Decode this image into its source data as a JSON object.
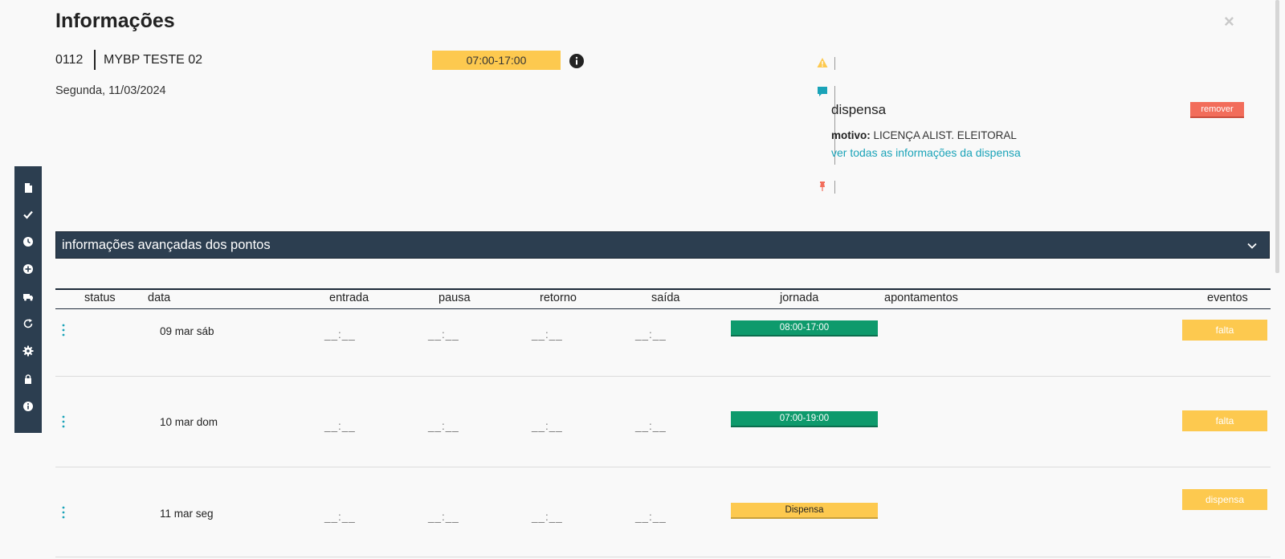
{
  "header": {
    "title": "Informações",
    "close": "×",
    "employee_code": "0112",
    "employee_name": "MYBP TESTE 02",
    "date": "Segunda, 11/03/2024",
    "shift": "07:00-17:00"
  },
  "side_panel": {
    "dispensa_title": "dispensa",
    "remove_label": "remover",
    "motivo_label": "motivo:",
    "motivo_value": "LICENÇA ALIST. ELEITORAL",
    "link": "ver todas as informações da dispensa",
    "colors": {
      "warning": "#fdc94f",
      "comment": "#1aa3b8",
      "pin": "#f26d5b",
      "remove": "#f26d5b"
    }
  },
  "toolbar": {
    "icons": [
      "file-icon",
      "check-icon",
      "clock-icon",
      "plus-circle-icon",
      "truck-icon",
      "refresh-icon",
      "gear-icon",
      "lock-icon",
      "info-icon"
    ]
  },
  "advanced": {
    "label": "informações avançadas dos pontos"
  },
  "table": {
    "headers": {
      "status": "status",
      "data": "data",
      "entrada": "entrada",
      "pausa": "pausa",
      "retorno": "retorno",
      "saida": "saída",
      "jornada": "jornada",
      "apontamentos": "apontamentos",
      "eventos": "eventos"
    },
    "rows": [
      {
        "date": "09 mar sáb",
        "entrada": "__:__",
        "pausa": "__:__",
        "retorno": "__:__",
        "saida": "__:__",
        "jornada": "08:00-17:00",
        "jornada_color": "#0e9a6c",
        "evento": "falta"
      },
      {
        "date": "10 mar dom",
        "entrada": "__:__",
        "pausa": "__:__",
        "retorno": "__:__",
        "saida": "__:__",
        "jornada": "07:00-19:00",
        "jornada_color": "#0e9a6c",
        "evento": "falta"
      },
      {
        "date": "11 mar seg",
        "entrada": "__:__",
        "pausa": "__:__",
        "retorno": "__:__",
        "saida": "__:__",
        "jornada": "Dispensa",
        "jornada_color": "#fdc94f",
        "evento": "dispensa"
      }
    ]
  }
}
